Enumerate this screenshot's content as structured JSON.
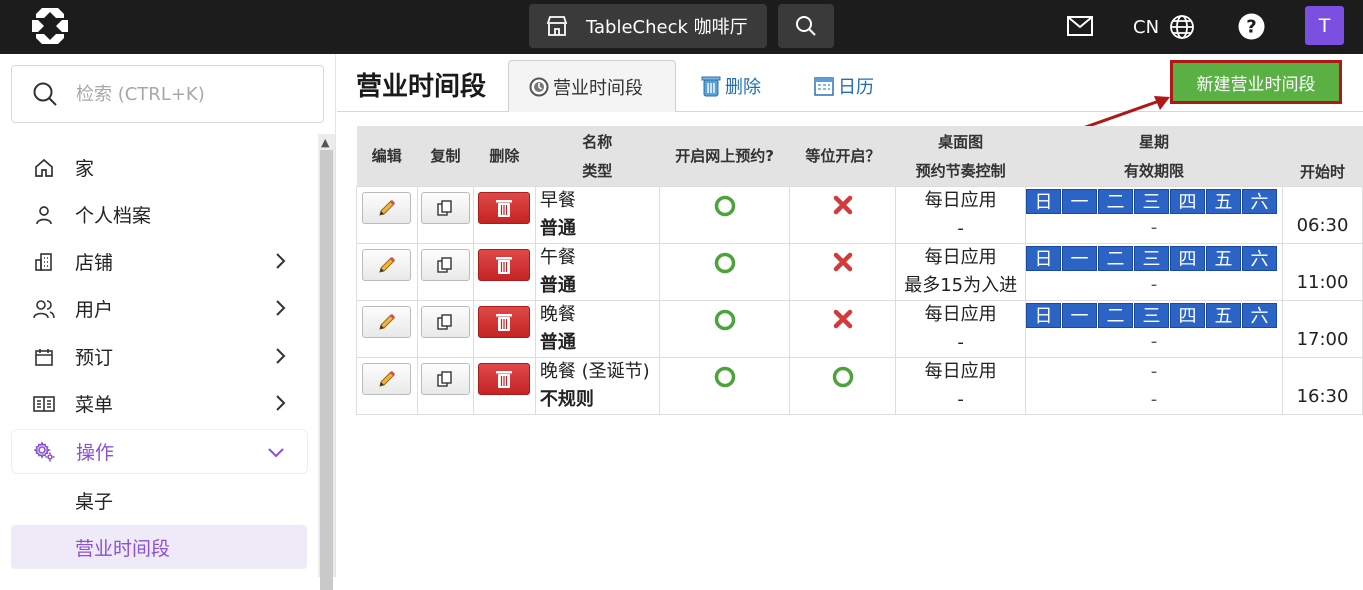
{
  "topbar": {
    "venue": "TableCheck 咖啡厅",
    "lang": "CN",
    "avatar_letter": "T"
  },
  "sidebar": {
    "search_placeholder": "检索 (CTRL+K)",
    "items": [
      {
        "label": "家",
        "icon": "home-icon"
      },
      {
        "label": "个人档案",
        "icon": "person-icon"
      },
      {
        "label": "店铺",
        "icon": "building-icon"
      },
      {
        "label": "用户",
        "icon": "users-icon"
      },
      {
        "label": "预订",
        "icon": "calendar-icon"
      },
      {
        "label": "菜单",
        "icon": "book-icon"
      },
      {
        "label": "操作",
        "icon": "gears-icon"
      }
    ],
    "sub_items": [
      "桌子",
      "营业时间段"
    ]
  },
  "page": {
    "title": "营业时间段",
    "tabs": [
      "营业时间段",
      "删除",
      "日历"
    ],
    "new_button": "新建营业时间段"
  },
  "table": {
    "headers": {
      "edit": "编辑",
      "copy": "复制",
      "delete": "删除",
      "name": "名称",
      "type": "类型",
      "online": "开启网上预约?",
      "waitlist": "等位开启？",
      "table_map": "桌面图",
      "pacing": "预约节奏控制",
      "weekday": "星期",
      "validity": "有效期限",
      "start_time": "开始时"
    },
    "weekdays": [
      "日",
      "一",
      "二",
      "三",
      "四",
      "五",
      "六"
    ],
    "rows": [
      {
        "name": "早餐",
        "type": "普通",
        "online": "yes",
        "waitlist": "no",
        "map": "每日应用",
        "pacing": "-",
        "weekdays_shown": true,
        "validity": "-",
        "start": "06:30"
      },
      {
        "name": "午餐",
        "type": "普通",
        "online": "yes",
        "waitlist": "no",
        "map": "每日应用",
        "pacing": "最多15为入进",
        "weekdays_shown": true,
        "validity": "-",
        "start": "11:00"
      },
      {
        "name": "晚餐",
        "type": "普通",
        "online": "yes",
        "waitlist": "no",
        "map": "每日应用",
        "pacing": "-",
        "weekdays_shown": true,
        "validity": "-",
        "start": "17:00"
      },
      {
        "name": "晚餐 (圣诞节)",
        "type": "不规则",
        "online": "yes",
        "waitlist": "yes",
        "map": "每日应用",
        "pacing": "-",
        "weekdays_shown": false,
        "weekday_text": "-",
        "validity": "-",
        "start": "16:30"
      }
    ]
  },
  "colors": {
    "accent": "#8a50d6",
    "new_button": "#5ab043",
    "annotation": "#b01818",
    "weekday_chip": "#2b64c4"
  }
}
